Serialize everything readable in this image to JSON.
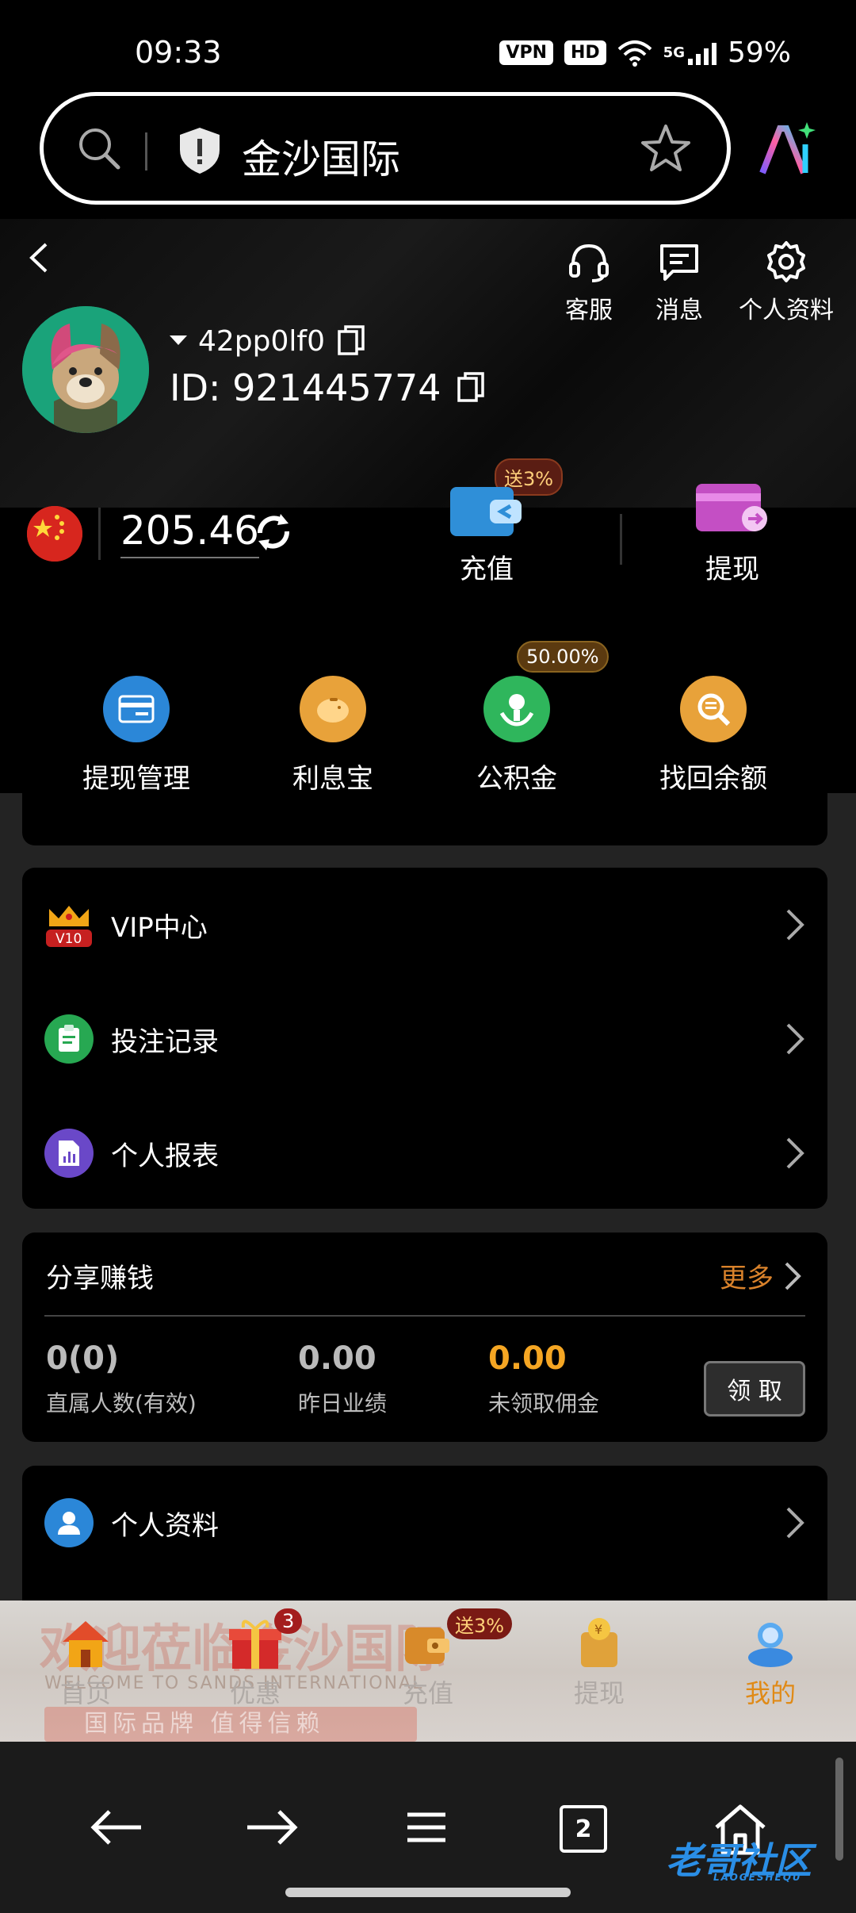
{
  "status_bar": {
    "time": "09:33",
    "vpn": "VPN",
    "hd": "HD",
    "network": "5G",
    "battery": "59%"
  },
  "browser": {
    "site_title": "金沙国际"
  },
  "header": {
    "actions": [
      {
        "label": "客服",
        "icon": "headset-icon"
      },
      {
        "label": "消息",
        "icon": "message-icon"
      },
      {
        "label": "个人资料",
        "icon": "gear-icon"
      }
    ],
    "username": "42pp0lf0",
    "user_id": "ID: 921445774",
    "balance": "205.46",
    "deposit_label": "充值",
    "deposit_badge": "送3%",
    "withdraw_label": "提现"
  },
  "features": [
    {
      "label": "提现管理",
      "color": "#2b87d8"
    },
    {
      "label": "利息宝",
      "color": "#e8a23a"
    },
    {
      "label": "公积金",
      "color": "#2fb65c",
      "badge": "50.00%"
    },
    {
      "label": "找回余额",
      "color": "#e8a23a"
    }
  ],
  "menu": {
    "vip": "VIP中心",
    "vip_level": "V10",
    "bets": "投注记录",
    "report": "个人报表"
  },
  "share": {
    "title": "分享赚钱",
    "more": "更多",
    "direct_value": "0(0)",
    "direct_label": "直属人数(有效)",
    "yesterday_value": "0.00",
    "yesterday_label": "昨日业绩",
    "unclaimed_value": "0.00",
    "unclaimed_label": "未领取佣金",
    "claim_button": "领 取"
  },
  "profile": {
    "label": "个人资料"
  },
  "tabbar": {
    "banner_title": "欢迎莅临金沙国际",
    "banner_sub": "WELCOME TO SANDS INTERNATIONAL",
    "banner_slogan": "国际品牌 值得信赖",
    "tabs": [
      {
        "label": "首页"
      },
      {
        "label": "优惠",
        "badge": "3"
      },
      {
        "label": "充值",
        "badge": "送3%"
      },
      {
        "label": "提现"
      },
      {
        "label": "我的"
      }
    ]
  },
  "system_nav": {
    "tabs_count": "2"
  },
  "watermark": {
    "text": "老哥社区",
    "sub": "LAOGESHEQU"
  },
  "colors": {
    "accent_orange": "#e08a16",
    "more_orange": "#d9822b",
    "unclaimed_yellow": "#f5a623"
  }
}
